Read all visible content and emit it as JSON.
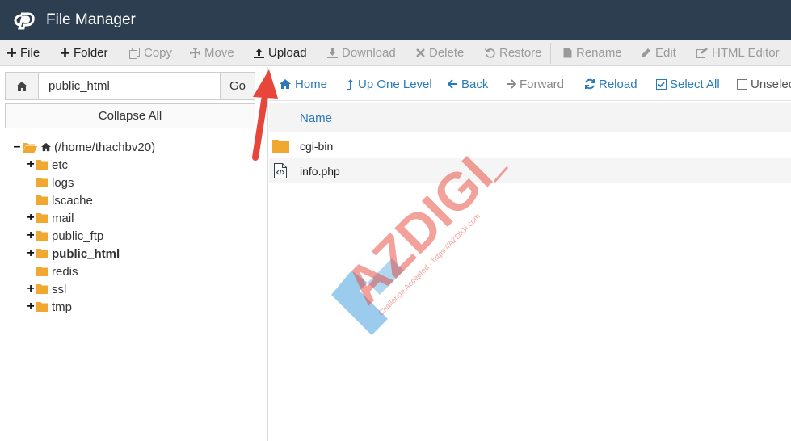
{
  "app": {
    "title": "File Manager"
  },
  "toolbar": {
    "file": "File",
    "folder": "Folder",
    "copy": "Copy",
    "move": "Move",
    "upload": "Upload",
    "download": "Download",
    "delete": "Delete",
    "restore": "Restore",
    "rename": "Rename",
    "edit": "Edit",
    "html_editor": "HTML Editor"
  },
  "path": {
    "value": "public_html",
    "go_label": "Go"
  },
  "collapse_label": "Collapse All",
  "tree": {
    "root": "(/home/thachbv20)",
    "items": [
      {
        "label": "etc",
        "expandable": true
      },
      {
        "label": "logs",
        "expandable": false
      },
      {
        "label": "lscache",
        "expandable": false
      },
      {
        "label": "mail",
        "expandable": true
      },
      {
        "label": "public_ftp",
        "expandable": true
      },
      {
        "label": "public_html",
        "expandable": true,
        "selected": true
      },
      {
        "label": "redis",
        "expandable": false
      },
      {
        "label": "ssl",
        "expandable": true
      },
      {
        "label": "tmp",
        "expandable": true
      }
    ]
  },
  "nav": {
    "home": "Home",
    "up": "Up One Level",
    "back": "Back",
    "forward": "Forward",
    "reload": "Reload",
    "select_all": "Select All",
    "unselect": "Unselec"
  },
  "list": {
    "column_name": "Name",
    "files": [
      {
        "name": "cgi-bin",
        "type": "folder"
      },
      {
        "name": "info.php",
        "type": "file"
      }
    ]
  },
  "watermark": {
    "brand": "AZDIGI",
    "tagline": "Challenge Accepted - https://AZDIGI.com"
  },
  "colors": {
    "header_bg": "#2d3e50",
    "link_blue": "#2a7ab8",
    "folder_orange": "#f0a830",
    "arrow_red": "#e8463a"
  }
}
